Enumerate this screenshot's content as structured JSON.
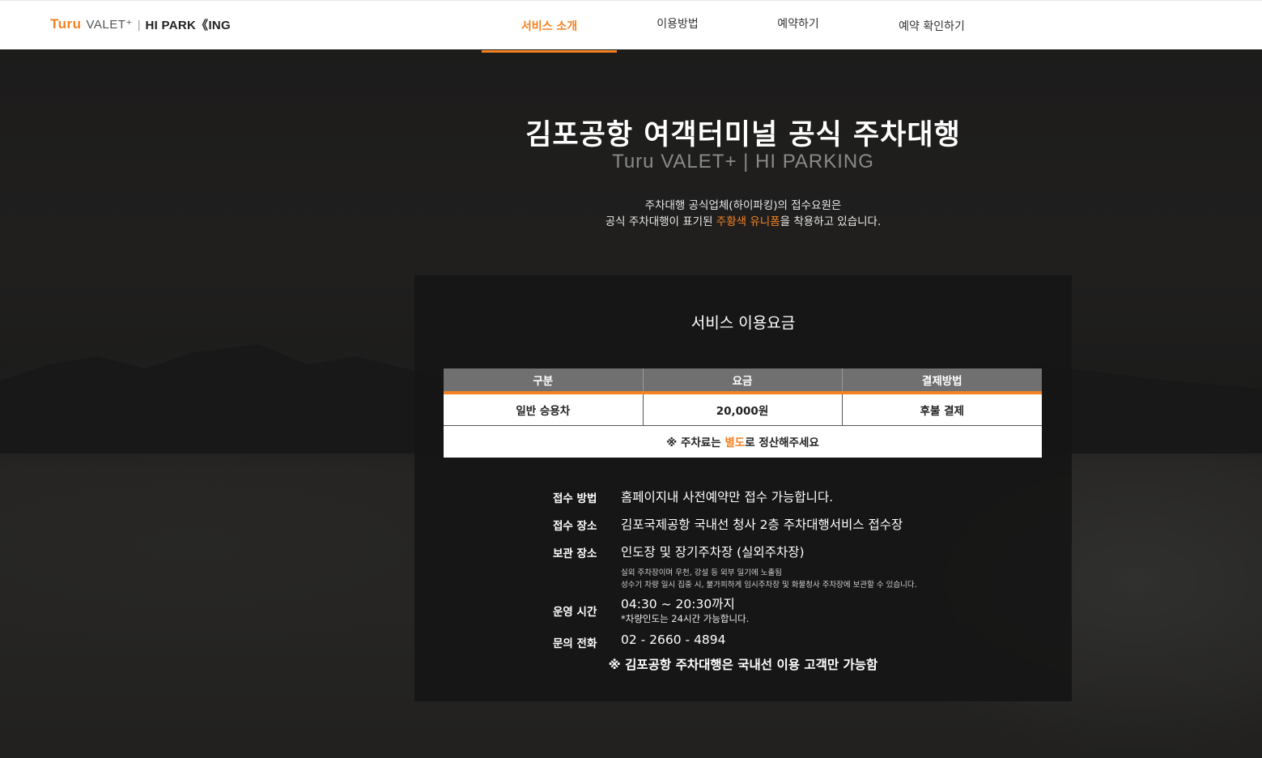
{
  "header": {
    "logo": {
      "turu": "Turu",
      "valet": "VALET⁺",
      "separator": "|",
      "hi_parking": "HI PARK《ING"
    },
    "nav": [
      {
        "label": "서비스 소개",
        "active": true
      },
      {
        "label": "이용방법",
        "active": false
      },
      {
        "label": "예약하기",
        "active": false
      },
      {
        "label": "예약 확인하기",
        "active": false
      }
    ]
  },
  "hero": {
    "title": "김포공항 여객터미널 공식 주차대행",
    "subtitle": "Turu VALET+ | HI PARKING",
    "desc_line1": "주차대행 공식업체(하이파킹)의 접수요원은",
    "desc_line2_pre": "공식 주차대행이 표기된 ",
    "desc_line2_highlight": "주황색 유니폼",
    "desc_line2_post": "을 착용하고 있습니다."
  },
  "card": {
    "title": "서비스 이용요금",
    "table": {
      "headers": [
        "구분",
        "요금",
        "결제방법"
      ],
      "row": [
        "일반 승용차",
        "20,000원",
        "후불 결제"
      ],
      "note_pre": "※ 주차료는 ",
      "note_highlight": "별도",
      "note_post": "로 정산해주세요"
    },
    "info": {
      "method_label": "접수 방법",
      "method_value": "홈페이지내 사전예약만 접수 가능합니다.",
      "place_label": "접수 장소",
      "place_value": "김포국제공항 국내선 청사 2층 주차대행서비스 접수장",
      "storage_label": "보관 장소",
      "storage_value": "인도장 및 장기주차장 (실외주차장)",
      "storage_note1": "실외 주차장이며 우천, 강설 등 외부 일기에 노출됨",
      "storage_note2": "성수기 차량 일시 집중 시, 불가피하게 임시주차장 및 화물청사 주차장에 보관할 수 있습니다.",
      "hours_label": "운영 시간",
      "hours_value": "04:30 ~ 20:30까지",
      "hours_note": "*차량인도는 24시간 가능합니다.",
      "phone_label": "문의 전화",
      "phone_value": "02 - 2660 - 4894"
    },
    "footnote": "※ 김포공항 주차대행은 국내선 이용 고객만 가능함"
  },
  "colors": {
    "accent": "#f58220",
    "header_bg": "#ffffff",
    "table_header": "#707070"
  }
}
